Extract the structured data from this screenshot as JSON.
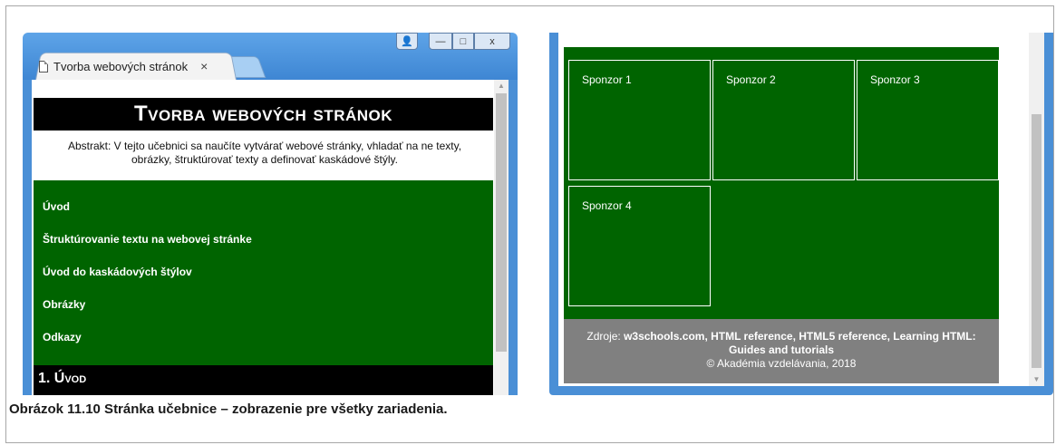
{
  "left_window": {
    "tab_title": "Tvorba webových stránok",
    "tab_close": "×",
    "controls": {
      "user": "👤",
      "minimize": "—",
      "maximize": "□",
      "close": "x"
    },
    "page": {
      "site_title": "Tvorba webových stránok",
      "abstract_line1": "Abstrakt: V tejto učebnici sa naučíte vytvárať webové stránky, vhladať na ne texty,",
      "abstract_line2": "obrázky, štruktúrovať texty a definovať kaskádové štýly.",
      "nav": [
        "Úvod",
        "Štruktúrovanie textu na webovej stránke",
        "Úvod do kaskádových štýlov",
        "Obrázky",
        "Odkazy"
      ],
      "section_heading": "1. Úvod"
    }
  },
  "right_window": {
    "sponsors": [
      "Sponzor 1",
      "Sponzor 2",
      "Sponzor 3",
      "Sponzor 4"
    ],
    "footer": {
      "prefix": "Zdroje: ",
      "sources_line1": "w3schools.com, HTML reference, HTML5 reference, Learning HTML:",
      "sources_line2": "Guides and tutorials",
      "copyright": "© Akadémia vzdelávania, 2018"
    }
  },
  "caption": "Obrázok 11.10 Stránka učebnice – zobrazenie pre všetky zariadenia.",
  "colors": {
    "nav_green": "#006400",
    "footer_gray": "#808080",
    "chrome_blue": "#4a8fd6"
  }
}
